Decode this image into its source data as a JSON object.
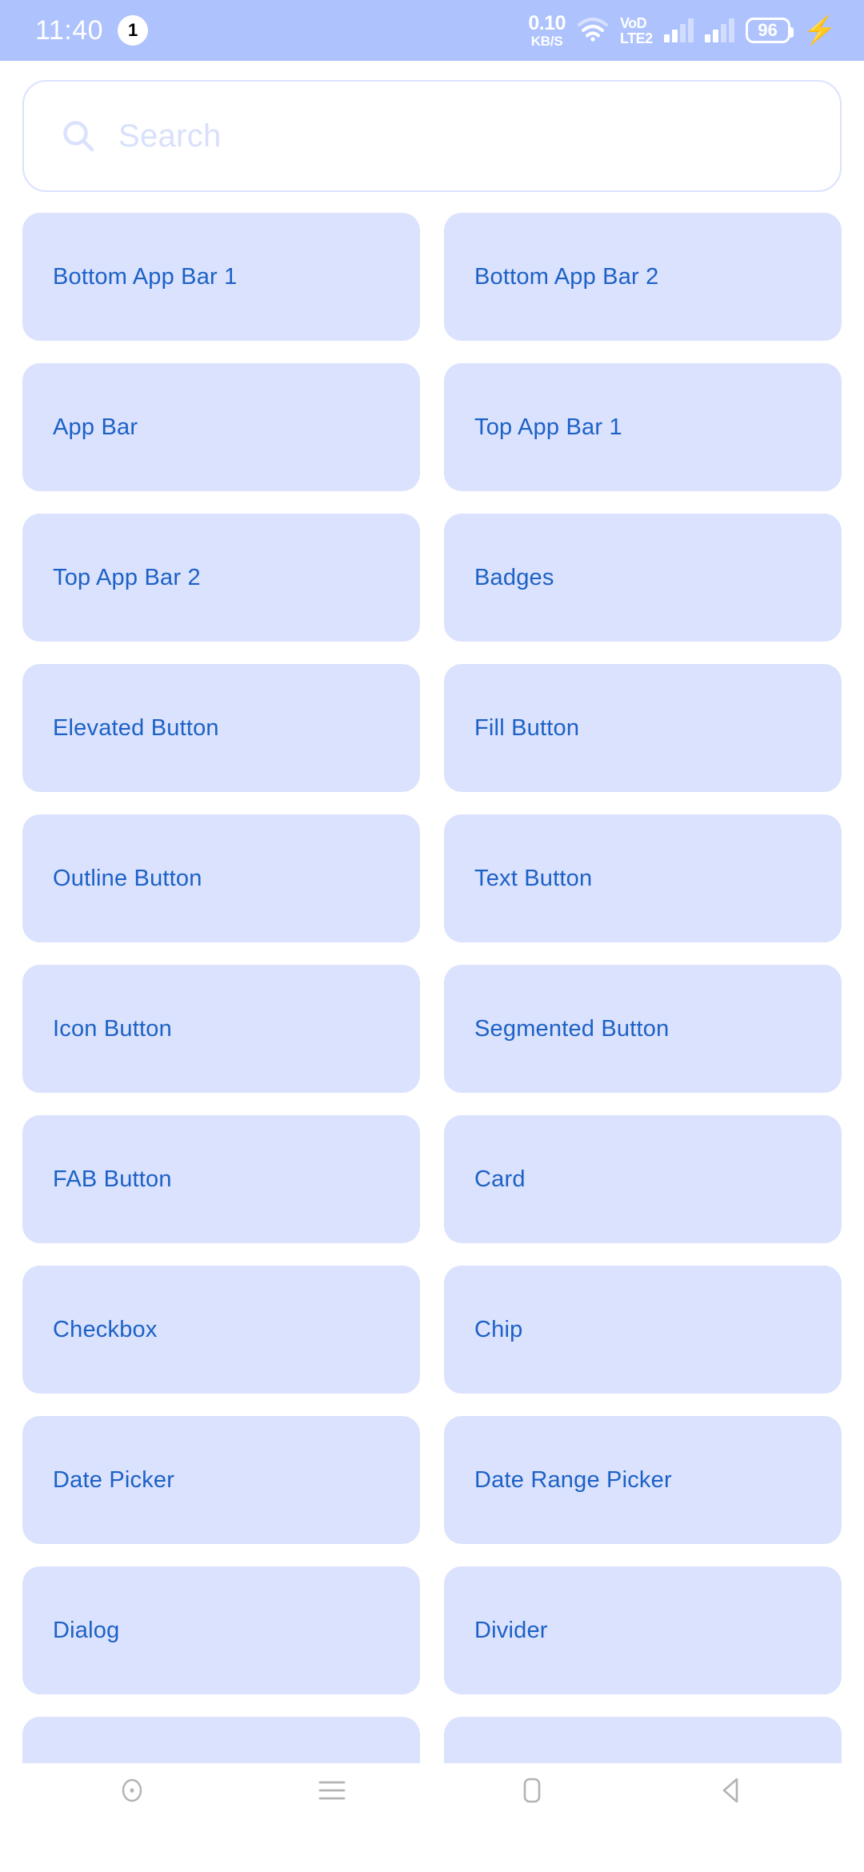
{
  "status_bar": {
    "time": "11:40",
    "notification_badge": "1",
    "network_speed_value": "0.10",
    "network_speed_unit": "KB/S",
    "wifi_icon": "wifi-icon",
    "volte_line1": "VoD",
    "volte_line2": "LTE2",
    "signal_icon_1": "signal-bars-icon",
    "signal_icon_2": "signal-bars-icon",
    "battery_percent": "96",
    "charging_icon": "charging-bolt-icon",
    "background_color": "#aec2fd",
    "foreground_color": "#ffffff"
  },
  "search": {
    "icon": "search-icon",
    "value": "",
    "placeholder": "Search"
  },
  "theme": {
    "card_background": "#dbe2fd",
    "card_text": "#1c61c6",
    "page_background": "#ffffff",
    "border_color": "#dbe2fd"
  },
  "grid": {
    "items": [
      {
        "label": "Bottom App Bar 1"
      },
      {
        "label": "Bottom App Bar 2"
      },
      {
        "label": "App Bar"
      },
      {
        "label": "Top App Bar 1"
      },
      {
        "label": "Top App Bar 2"
      },
      {
        "label": "Badges"
      },
      {
        "label": "Elevated Button"
      },
      {
        "label": "Fill Button"
      },
      {
        "label": "Outline Button"
      },
      {
        "label": "Text Button"
      },
      {
        "label": "Icon Button"
      },
      {
        "label": "Segmented Button"
      },
      {
        "label": "FAB Button"
      },
      {
        "label": "Card"
      },
      {
        "label": "Checkbox"
      },
      {
        "label": "Chip"
      },
      {
        "label": "Date Picker"
      },
      {
        "label": "Date Range Picker"
      },
      {
        "label": "Dialog"
      },
      {
        "label": "Divider"
      },
      {
        "label": ""
      },
      {
        "label": ""
      }
    ]
  },
  "nav_bar": {
    "buttons": [
      {
        "name": "recent-dot-icon"
      },
      {
        "name": "menu-icon"
      },
      {
        "name": "home-icon"
      },
      {
        "name": "back-icon"
      }
    ]
  }
}
